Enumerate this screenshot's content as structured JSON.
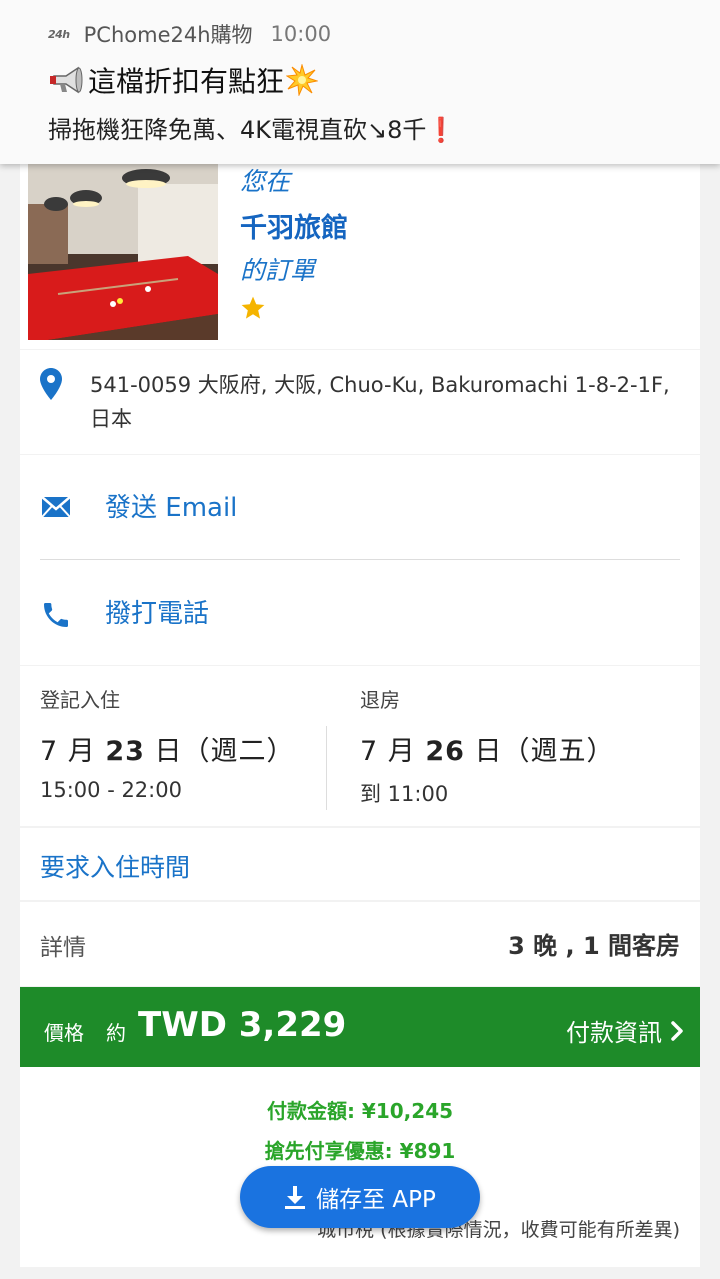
{
  "notification": {
    "logo_text": "24h",
    "app_name": "PChome24h購物",
    "time": "10:00",
    "title": "這檔折扣有點狂",
    "body": "掃拖機狂降免萬、4K電視直砍↘8千❗"
  },
  "hotel": {
    "you_at": "您在",
    "name": "千羽旅館",
    "your_order": "的訂單",
    "stars": 1
  },
  "address": {
    "text": "541-0059 大阪府, 大阪, Chuo-Ku, Bakuromachi 1-8-2-1F, 日本"
  },
  "contact": {
    "email_label": "發送 Email",
    "phone_label": "撥打電話"
  },
  "dates": {
    "checkin_label": "登記入住",
    "checkin_month": "7 月 ",
    "checkin_day": "23",
    "checkin_rest": " 日（週二）",
    "checkin_time": "15:00 - 22:00",
    "checkout_label": "退房",
    "checkout_month": "7 月 ",
    "checkout_day": "26",
    "checkout_rest": " 日（週五）",
    "checkout_time": "到 11:00"
  },
  "request": {
    "label": "要求入住時間"
  },
  "details": {
    "label": "詳情",
    "value": "3 晚 , 1 間客房"
  },
  "price": {
    "label": "價格",
    "approx": "約",
    "value": "TWD 3,229",
    "pay_info": "付款資訊"
  },
  "payment": {
    "amount": "付款金額: ¥10,245",
    "discount": "搶先付享優惠: ¥891",
    "tax_note": "城市稅 (根據實際情況，收費可能有所差異)"
  },
  "save_button": {
    "label": "儲存至 APP"
  },
  "colors": {
    "link_blue": "#1a73c8",
    "price_green": "#1e8b29",
    "amount_green": "#2aa52a",
    "button_blue": "#1a73e0",
    "star_gold": "#f5b400"
  }
}
